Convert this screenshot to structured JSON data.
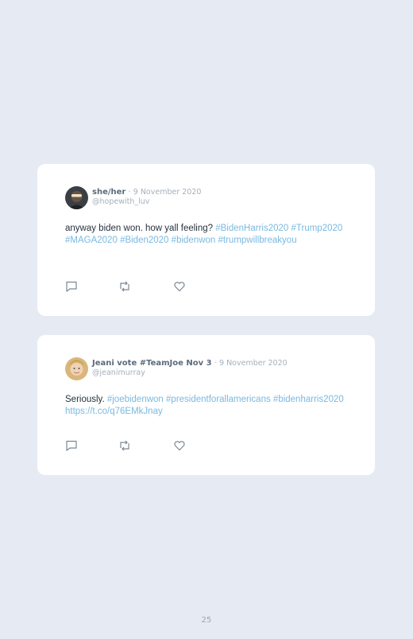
{
  "tweets": [
    {
      "author": "she/her",
      "separator": "·",
      "date": "9 November 2020",
      "handle": "@hopewith_luv",
      "text_parts": [
        {
          "text": "anyway biden won. how yall feeling? ",
          "kind": "plain"
        },
        {
          "text": "#BidenHarris2020",
          "kind": "tag"
        },
        {
          "text": "#Trump2020",
          "kind": "tag"
        },
        {
          "text": "#MAGA2020",
          "kind": "tag"
        },
        {
          "text": "#Biden2020",
          "kind": "tag"
        },
        {
          "text": "#bidenwon",
          "kind": "tag"
        },
        {
          "text": "#trumpwillbreakyou",
          "kind": "tag"
        }
      ]
    },
    {
      "author": "Jeani vote #TeamJoe Nov 3",
      "separator": "·",
      "date": "9 November 2020",
      "handle": "@jeanimurray",
      "text_parts": [
        {
          "text": "Seriously. ",
          "kind": "plain"
        },
        {
          "text": "#joebidenwon",
          "kind": "tag"
        },
        {
          "text": "#presidentforallamericans",
          "kind": "tag"
        },
        {
          "text": "#bidenharris2020",
          "kind": "tag"
        },
        {
          "text": "https://t.co/q76EMkJnay",
          "kind": "tag"
        }
      ]
    }
  ],
  "icons": {
    "reply": "reply-icon",
    "retweet": "retweet-icon",
    "like": "heart-icon"
  },
  "colors": {
    "background": "#e6ebf3",
    "card": "#ffffff",
    "hashtag": "#79b9e0",
    "author": "#5a6b7c",
    "meta": "#a5b0bb"
  },
  "page_number": "25"
}
